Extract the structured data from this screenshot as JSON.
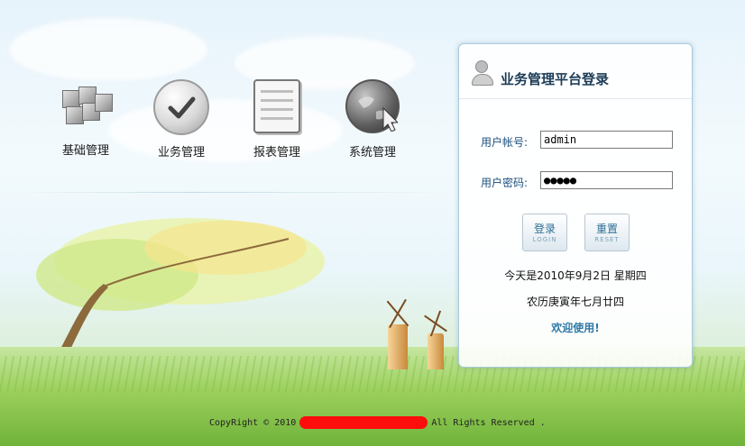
{
  "modules": [
    {
      "label": "基础管理",
      "icon": "cubes-icon"
    },
    {
      "label": "业务管理",
      "icon": "check-circle-icon"
    },
    {
      "label": "报表管理",
      "icon": "report-calendar-icon"
    },
    {
      "label": "系统管理",
      "icon": "globe-cursor-icon"
    }
  ],
  "login": {
    "title": "业务管理平台登录",
    "username_label": "用户帐号:",
    "username_value": "admin",
    "password_label": "用户密码:",
    "password_value": "●●●●●",
    "login_button": {
      "label": "登录",
      "sub": "LOGIN"
    },
    "reset_button": {
      "label": "重置",
      "sub": "RESET"
    },
    "date_text": "今天是2010年9月2日  星期四",
    "lunar_text": "农历庚寅年七月廿四",
    "welcome_text": "欢迎使用!"
  },
  "footer": {
    "prefix": "CopyRight © 2010",
    "suffix": "All Rights Reserved ."
  },
  "colors": {
    "accent": "#1d4f7e",
    "title": "#1b3b56",
    "welcome": "#2e79a7",
    "redaction": "#ff0c0c"
  }
}
